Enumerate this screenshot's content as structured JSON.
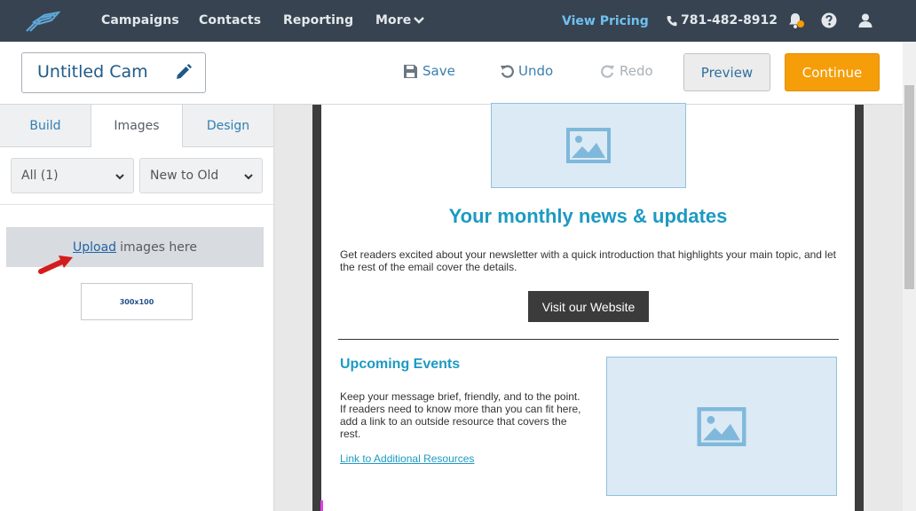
{
  "nav": {
    "items": [
      "Campaigns",
      "Contacts",
      "Reporting",
      "More"
    ],
    "pricing": "View Pricing",
    "phone": "781-482-8912"
  },
  "toolbar": {
    "title_value": "Untitled Campaign",
    "save": "Save",
    "undo": "Undo",
    "redo": "Redo",
    "preview": "Preview",
    "continue": "Continue"
  },
  "left": {
    "tabs": [
      "Build",
      "Images",
      "Design"
    ],
    "active_tab": "Images",
    "filter_value": "All (1)",
    "sort_value": "New to Old",
    "upload_link": "Upload",
    "upload_text": "images here",
    "thumb_label": "300x100"
  },
  "email": {
    "headline": "Your monthly news & updates",
    "intro": "Get readers excited about your newsletter with a quick introduction that highlights your main topic, and let the rest of the email cover the details.",
    "button": "Visit our Website",
    "events_title": "Upcoming Events",
    "events_body": "Keep your message brief, friendly, and to the point. If readers need to know more than you can fit here, add a link to an outside resource that covers the rest.",
    "events_link": "Link to Additional Resources"
  },
  "colors": {
    "nav_bg": "#374351",
    "accent_orange": "#f59e09",
    "link_blue": "#1c9ac2",
    "pricing_blue": "#6fc1f0"
  }
}
